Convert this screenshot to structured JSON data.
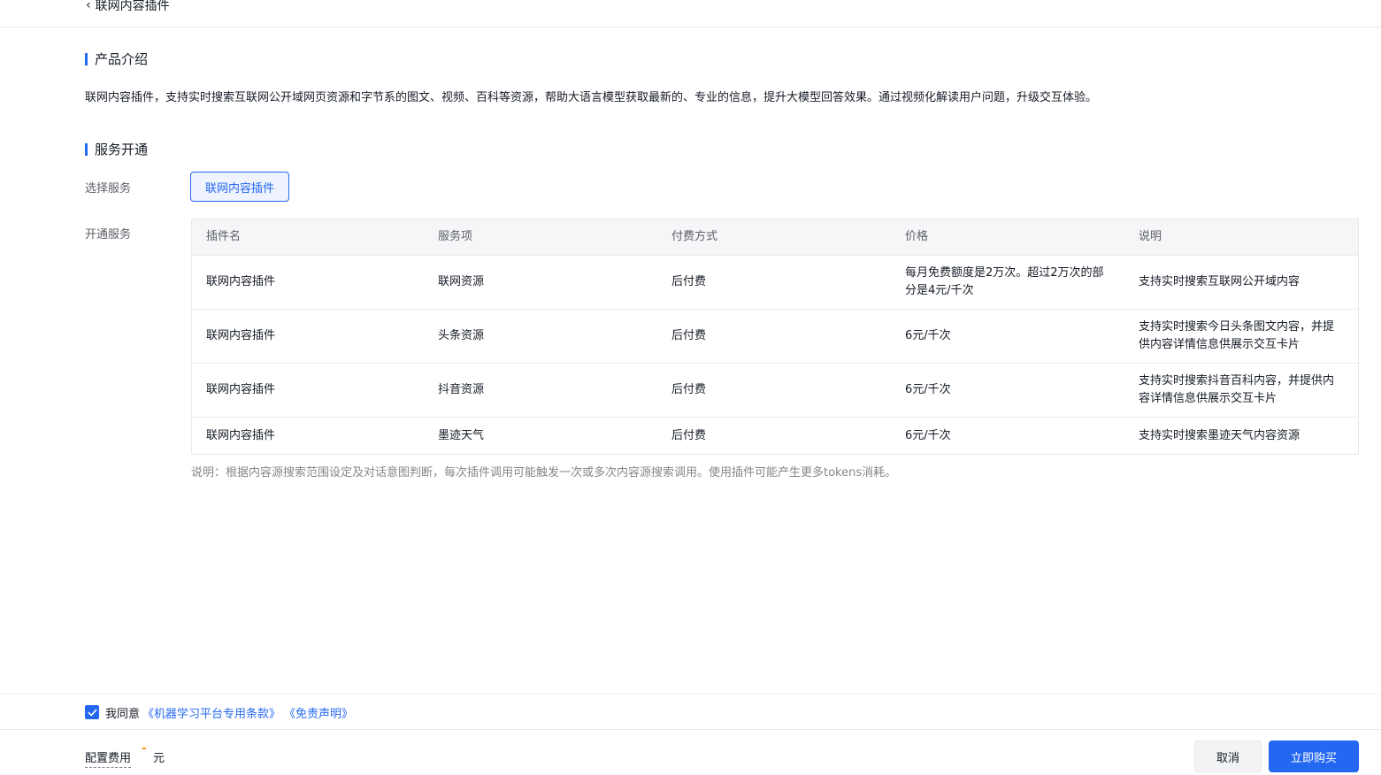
{
  "header": {
    "back_label": "联网内容插件"
  },
  "product_intro": {
    "title": "产品介绍",
    "text": "联网内容插件，支持实时搜索互联网公开域网页资源和字节系的图文、视频、百科等资源，帮助大语言模型获取最新的、专业的信息，提升大模型回答效果。通过视频化解读用户问题，升级交互体验。"
  },
  "service": {
    "title": "服务开通",
    "select_label": "选择服务",
    "selected_service": "联网内容插件",
    "open_label": "开通服务",
    "table": {
      "headers": [
        "插件名",
        "服务项",
        "付费方式",
        "价格",
        "说明"
      ],
      "rows": [
        {
          "plugin": "联网内容插件",
          "item": "联网资源",
          "billing": "后付费",
          "price": "每月免费额度是2万次。超过2万次的部分是4元/千次",
          "desc": "支持实时搜索互联网公开域内容"
        },
        {
          "plugin": "联网内容插件",
          "item": "头条资源",
          "billing": "后付费",
          "price": "6元/千次",
          "desc": "支持实时搜索今日头条图文内容，并提供内容详情信息供展示交互卡片"
        },
        {
          "plugin": "联网内容插件",
          "item": "抖音资源",
          "billing": "后付费",
          "price": "6元/千次",
          "desc": "支持实时搜索抖音百科内容，并提供内容详情信息供展示交互卡片"
        },
        {
          "plugin": "联网内容插件",
          "item": "墨迹天气",
          "billing": "后付费",
          "price": "6元/千次",
          "desc": "支持实时搜索墨迹天气内容资源"
        }
      ]
    },
    "note": "说明：根据内容源搜索范围设定及对话意图判断，每次插件调用可能触发一次或多次内容源搜索调用。使用插件可能产生更多tokens消耗。"
  },
  "agreement": {
    "checked": true,
    "prefix": "我同意",
    "link1": "《机器学习平台专用条款》",
    "link2": "《免责声明》"
  },
  "footer": {
    "cost_label": "配置费用",
    "cost_value": "-",
    "cost_unit": "元",
    "cancel_label": "取消",
    "buy_label": "立即购买"
  },
  "colors": {
    "accent": "#2468f2",
    "cost": "#ff9326"
  }
}
